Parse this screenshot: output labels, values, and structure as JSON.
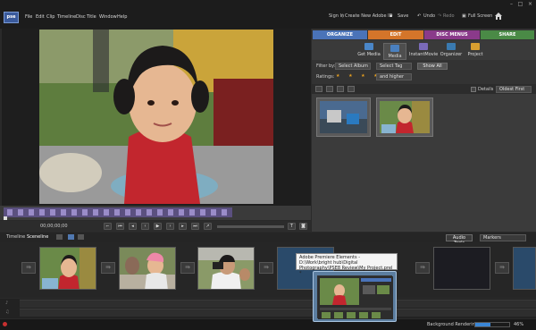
{
  "app": {
    "logo_text": "pse",
    "menu": [
      "File",
      "Edit",
      "Clip",
      "Timeline",
      "Disc",
      "Title",
      "Window",
      "Help"
    ],
    "signin": "Sign In",
    "create_id": "Create New Adobe ID",
    "save": "Save",
    "undo": "Undo",
    "redo": "Redo",
    "fullscreen": "Full Screen"
  },
  "monitor": {
    "timecode": "00;00;00;00"
  },
  "tabs": [
    "ORGANIZE",
    "EDIT",
    "DISC MENUS",
    "SHARE"
  ],
  "tools": [
    "Get Media",
    "Media",
    "InstantMovie",
    "Organizer",
    "Project"
  ],
  "filters": {
    "filter_by_label": "Filter by:",
    "album": "Select Album",
    "tag": "Select Tag",
    "show_all": "Show All",
    "ratings_label": "Ratings:",
    "rating_stars": "★ ★ ★ ★ ★",
    "rating_mode": "and higher"
  },
  "view": {
    "details": "Details",
    "sort": "Oldest First"
  },
  "timeline": {
    "tabs": [
      "Timeline",
      "Sceneline"
    ],
    "audio_tools": "Audio Tools",
    "markers": "Markers"
  },
  "tooltip": {
    "text": "Adobe Premiere Elements - D:\\Work\\bright hub\\Digital Photography\\PSE8 Review\\My Project.prel *"
  },
  "status": {
    "rendering": "Background Rendering...",
    "progress_percent": "46%",
    "progress_value": 0.46
  },
  "colors": {
    "organize": "#4a73b8",
    "edit": "#d4752a",
    "disc": "#8a3a8a",
    "share": "#4a8a46"
  }
}
